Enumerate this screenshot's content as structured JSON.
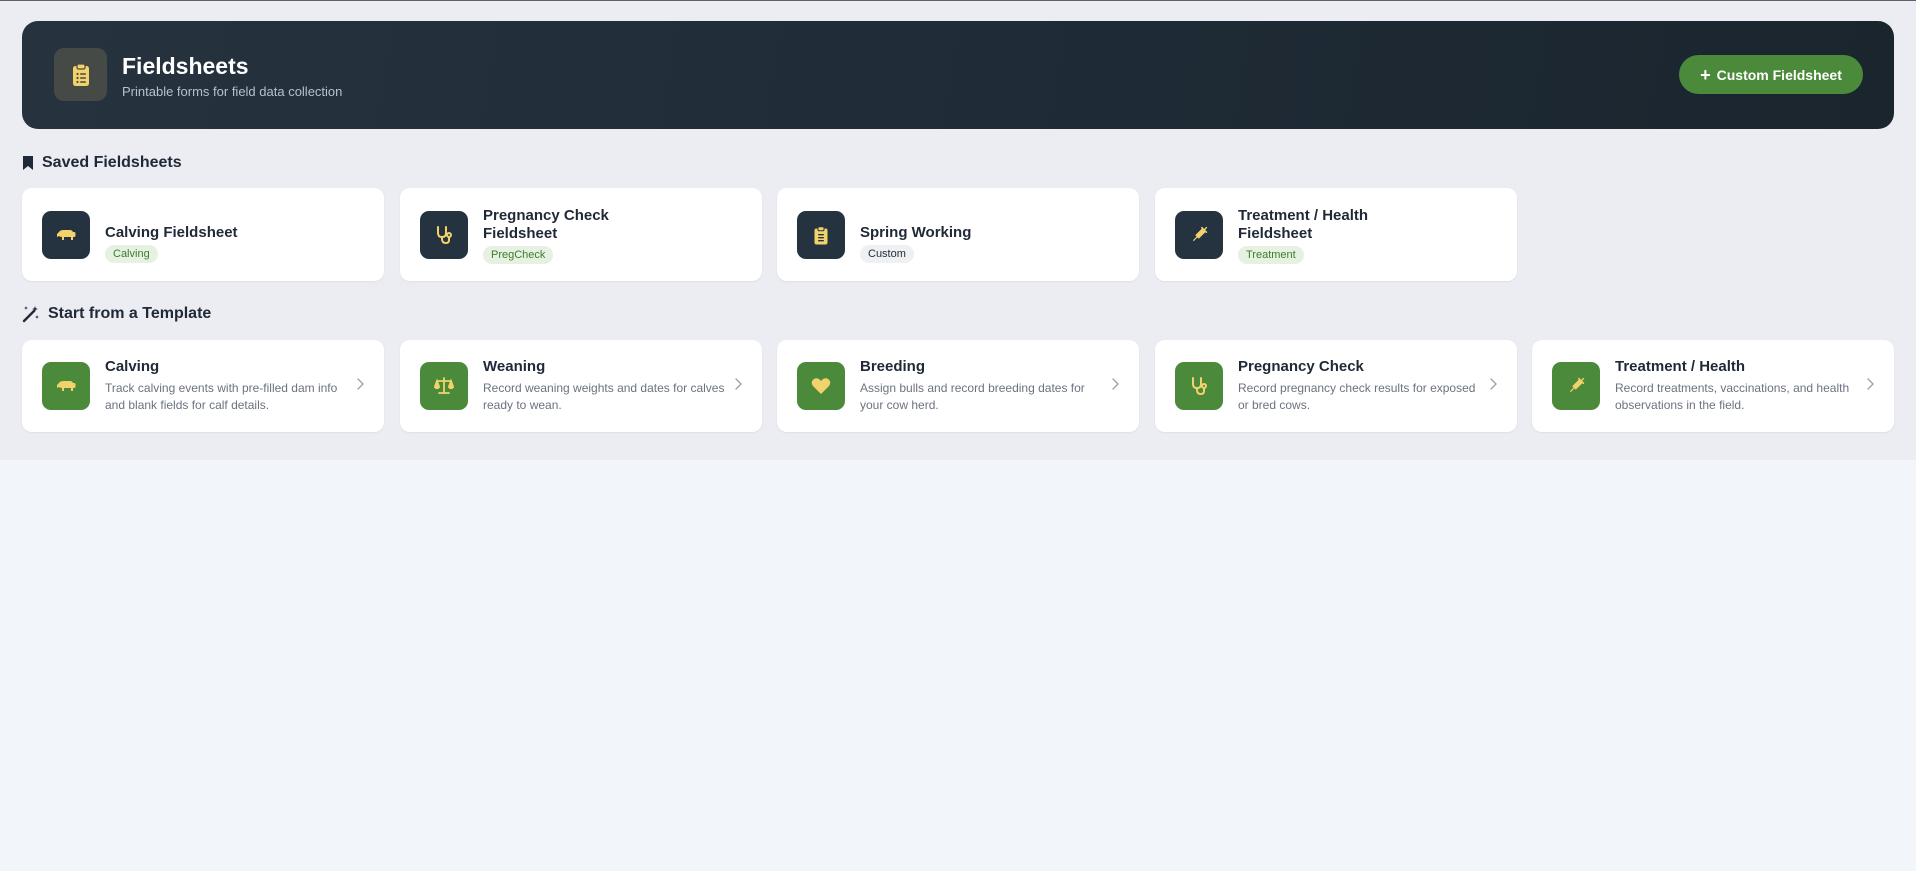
{
  "header": {
    "title": "Fieldsheets",
    "subtitle": "Printable forms for field data collection",
    "custom_button_label": "Custom Fieldsheet",
    "icon": "clipboard-icon"
  },
  "saved": {
    "section_title": "Saved Fieldsheets",
    "section_icon": "bookmark-icon",
    "items": [
      {
        "title": "Calving Fieldsheet",
        "badge": "Calving",
        "icon": "cow-icon"
      },
      {
        "title": "Pregnancy Check Fieldsheet",
        "title_line1": "Pregnancy Check",
        "title_line2": "Fieldsheet",
        "badge": "PregCheck",
        "icon": "stethoscope-icon"
      },
      {
        "title": "Spring Working",
        "badge": "Custom",
        "icon": "clipboard-icon"
      },
      {
        "title": "Treatment / Health Fieldsheet",
        "title_line1": "Treatment / Health",
        "title_line2": "Fieldsheet",
        "badge": "Treatment",
        "icon": "syringe-icon"
      }
    ]
  },
  "templates": {
    "section_title": "Start from a Template",
    "section_icon": "magic-wand-icon",
    "items": [
      {
        "title": "Calving",
        "desc": "Track calving events with pre-filled dam info and blank fields for calf details.",
        "icon": "cow-icon"
      },
      {
        "title": "Weaning",
        "desc": "Record weaning weights and dates for calves ready to wean.",
        "icon": "scale-icon"
      },
      {
        "title": "Breeding",
        "desc": "Assign bulls and record breeding dates for your cow herd.",
        "icon": "heart-icon"
      },
      {
        "title": "Pregnancy Check",
        "desc": "Record pregnancy check results for exposed or bred cows.",
        "icon": "stethoscope-icon"
      },
      {
        "title": "Treatment / Health",
        "desc": "Record treatments, vaccinations, and health observations in the field.",
        "icon": "syringe-icon"
      }
    ]
  },
  "colors": {
    "header_bg": "#1e2a35",
    "accent_green": "#4b8a3a",
    "icon_yellow": "#f2d36b",
    "dark_icon_bg": "#253340"
  }
}
